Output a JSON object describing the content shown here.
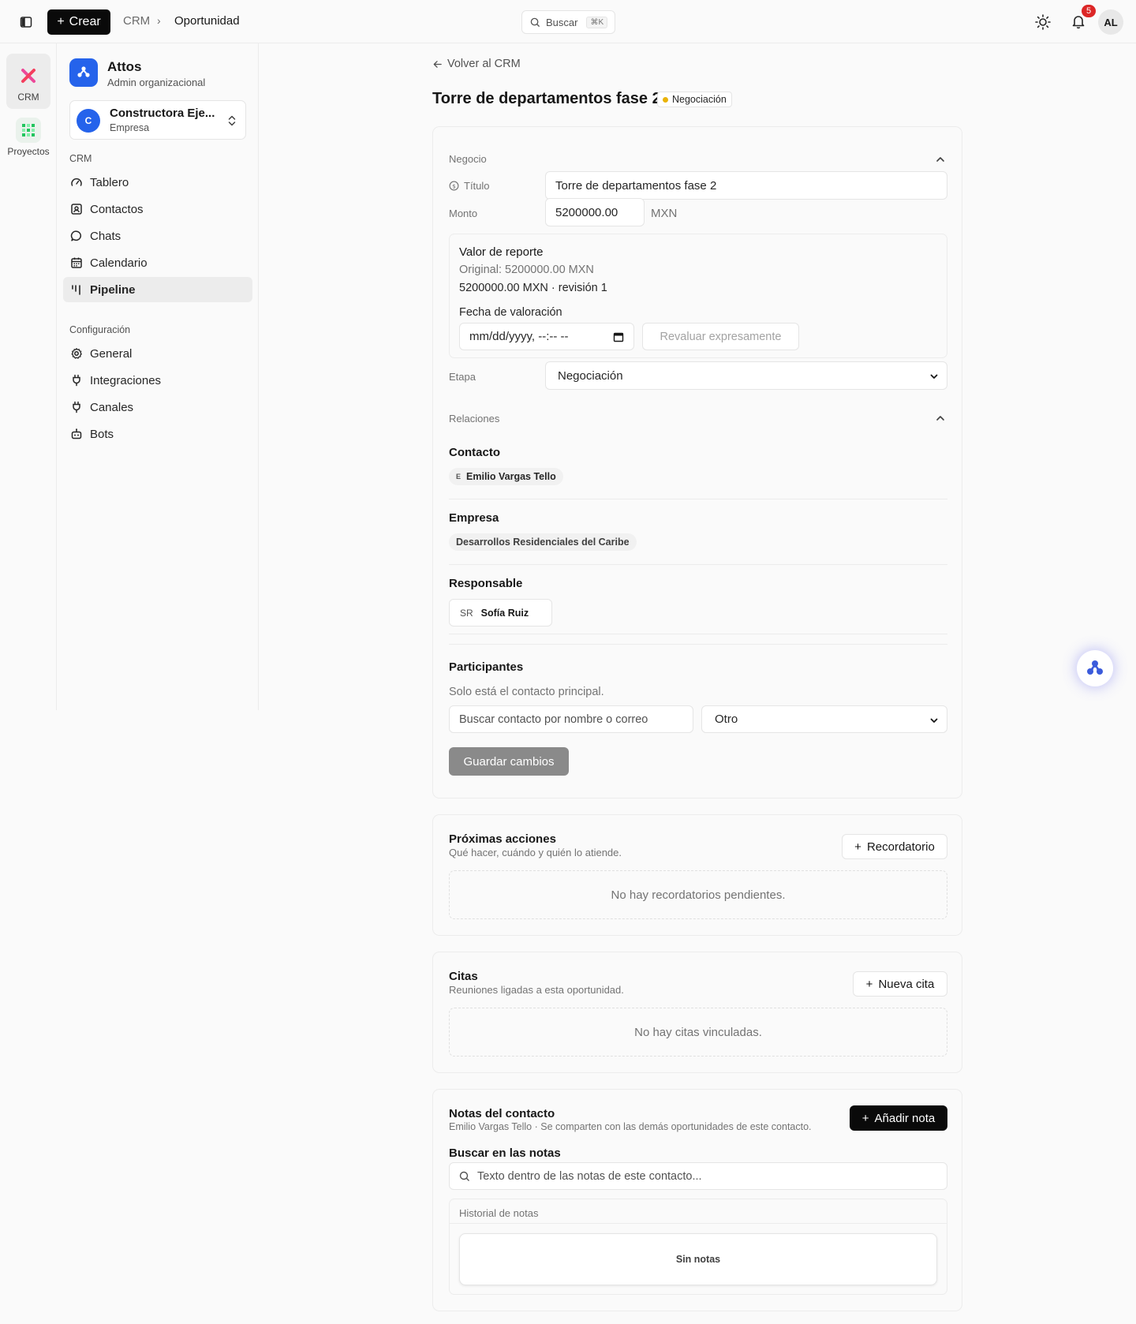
{
  "topbar": {
    "create_label": "Crear",
    "breadcrumb": [
      "CRM",
      "Oportunidad"
    ],
    "search_label": "Buscar",
    "search_shortcut": "⌘K",
    "notification_count": "5",
    "user_initials": "AL"
  },
  "rail": {
    "items": [
      {
        "label": "CRM",
        "icon": "crm-icon"
      },
      {
        "label": "Proyectos",
        "icon": "projects-icon"
      }
    ]
  },
  "sidebar": {
    "org_name": "Attos",
    "org_role": "Admin organizacional",
    "company": {
      "initial": "C",
      "name": "Constructora Eje...",
      "type": "Empresa"
    },
    "crm_section_label": "CRM",
    "crm_items": [
      {
        "label": "Tablero",
        "icon": "dashboard-gauge-icon"
      },
      {
        "label": "Contactos",
        "icon": "contacts-icon"
      },
      {
        "label": "Chats",
        "icon": "chat-bubble-icon"
      },
      {
        "label": "Calendario",
        "icon": "calendar-icon"
      },
      {
        "label": "Pipeline",
        "icon": "pipeline-icon",
        "active": true
      }
    ],
    "config_section_label": "Configuración",
    "config_items": [
      {
        "label": "General",
        "icon": "gear-icon"
      },
      {
        "label": "Integraciones",
        "icon": "plug-icon"
      },
      {
        "label": "Canales",
        "icon": "plug-icon"
      },
      {
        "label": "Bots",
        "icon": "bot-icon"
      }
    ]
  },
  "page": {
    "back_label": "Volver al CRM",
    "title": "Torre de departamentos fase 2",
    "stage_badge": "Negociación",
    "stage_color": "#eab308"
  },
  "deal": {
    "section_label": "Negocio",
    "title_label": "Título",
    "title_value": "Torre de departamentos fase 2",
    "amount_label": "Monto",
    "amount_value": "5200000.00",
    "currency": "MXN",
    "report": {
      "title": "Valor de reporte",
      "original": "Original: 5200000.00 MXN",
      "current": "5200000.00 MXN · revisión 1",
      "date_label": "Fecha de valoración",
      "date_placeholder": "mm/dd/yyyy, --:-- --",
      "revalue_label": "Revaluar expresamente"
    },
    "stage_label": "Etapa",
    "stage_value": "Negociación"
  },
  "relations": {
    "section_label": "Relaciones",
    "contact_label": "Contacto",
    "contact_initial": "E",
    "contact_name": "Emilio Vargas Tello",
    "company_label": "Empresa",
    "company_name": "Desarrollos Residenciales del Caribe",
    "owner_label": "Responsable",
    "owner_initials": "SR",
    "owner_name": "Sofía Ruiz",
    "participants_label": "Participantes",
    "participants_note": "Solo está el contacto principal.",
    "participant_search_placeholder": "Buscar contacto por nombre o correo",
    "participant_role": "Otro",
    "save_label": "Guardar cambios"
  },
  "next_actions": {
    "title": "Próximas acciones",
    "subtitle": "Qué hacer, cuándo y quién lo atiende.",
    "button": "Recordatorio",
    "empty": "No hay recordatorios pendientes."
  },
  "meetings": {
    "title": "Citas",
    "subtitle": "Reuniones ligadas a esta oportunidad.",
    "button": "Nueva cita",
    "empty": "No hay citas vinculadas."
  },
  "notes": {
    "title": "Notas del contacto",
    "subtitle": "Emilio Vargas Tello · Se comparten con las demás oportunidades de este contacto.",
    "button": "Añadir nota",
    "search_label": "Buscar en las notas",
    "search_placeholder": "Texto dentro de las notas de este contacto...",
    "history_label": "Historial de notas",
    "empty": "Sin notas"
  }
}
